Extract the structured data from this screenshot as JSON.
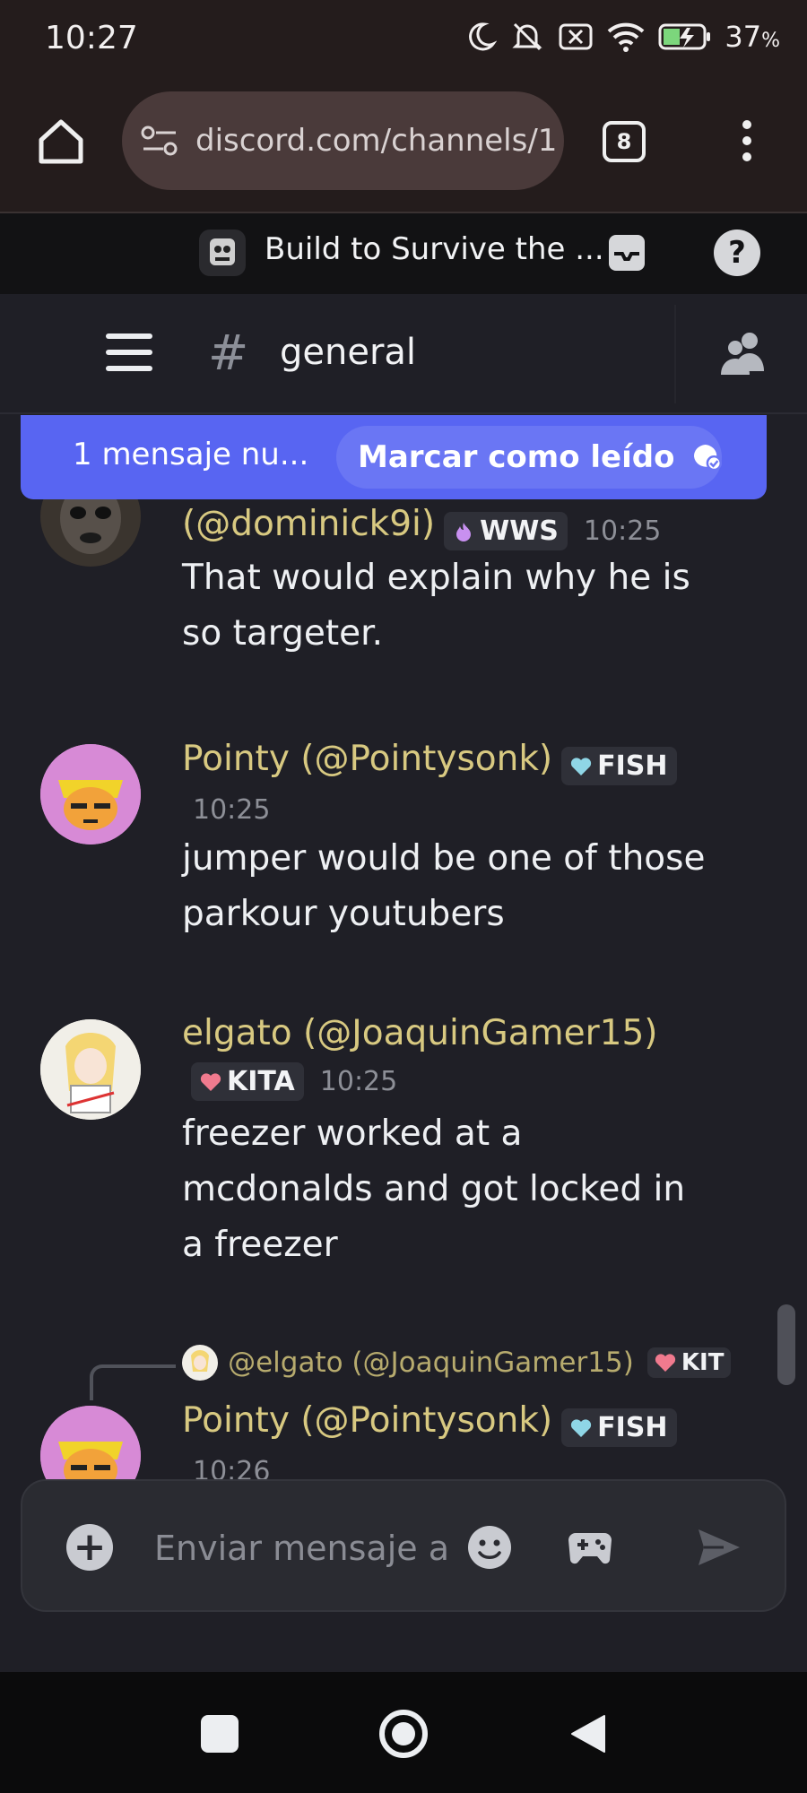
{
  "status_bar": {
    "time": "10:27",
    "battery": "37",
    "battery_unit": "%"
  },
  "browser": {
    "url": "discord.com/channels/1",
    "tab_count": "8"
  },
  "server": {
    "name": "Build to Survive the ..."
  },
  "channel": {
    "name": "general"
  },
  "banner": {
    "new_messages": "1 mensaje nu...",
    "mark_read": "Marcar como leído"
  },
  "messages": [
    {
      "name_partial": "dominick9i",
      "name": "(@dominick9i)",
      "tag": "WWS",
      "time": "10:25",
      "lines": [
        "That would explain why he is",
        "so targeter."
      ]
    },
    {
      "name": "Pointy (@Pointysonk)",
      "tag": "FISH",
      "time": "10:25",
      "lines": [
        "jumper would be one of those",
        "parkour youtubers"
      ]
    },
    {
      "name": "elgato (@JoaquinGamer15)",
      "tag": "KITA",
      "time": "10:25",
      "lines": [
        "freezer worked at a",
        "mcdonalds and got locked in",
        "a freezer"
      ]
    },
    {
      "reply_to": "@elgato (@JoaquinGamer15)",
      "reply_tag": "KIT",
      "name": "Pointy (@Pointysonk)",
      "tag": "FISH",
      "time": "10:26"
    }
  ],
  "composer": {
    "placeholder": "Enviar mensaje a"
  },
  "colors": {
    "accent": "#5865f2",
    "username": "#d8c981",
    "background": "#1f1f26"
  },
  "icons": [
    "home-icon",
    "site-settings-icon",
    "menu-dots-icon",
    "inbox-icon",
    "help-icon",
    "hamburger-icon",
    "hash-icon",
    "members-icon",
    "mark-read-icon",
    "add-icon",
    "emoji-icon",
    "gamepad-icon",
    "send-icon"
  ]
}
